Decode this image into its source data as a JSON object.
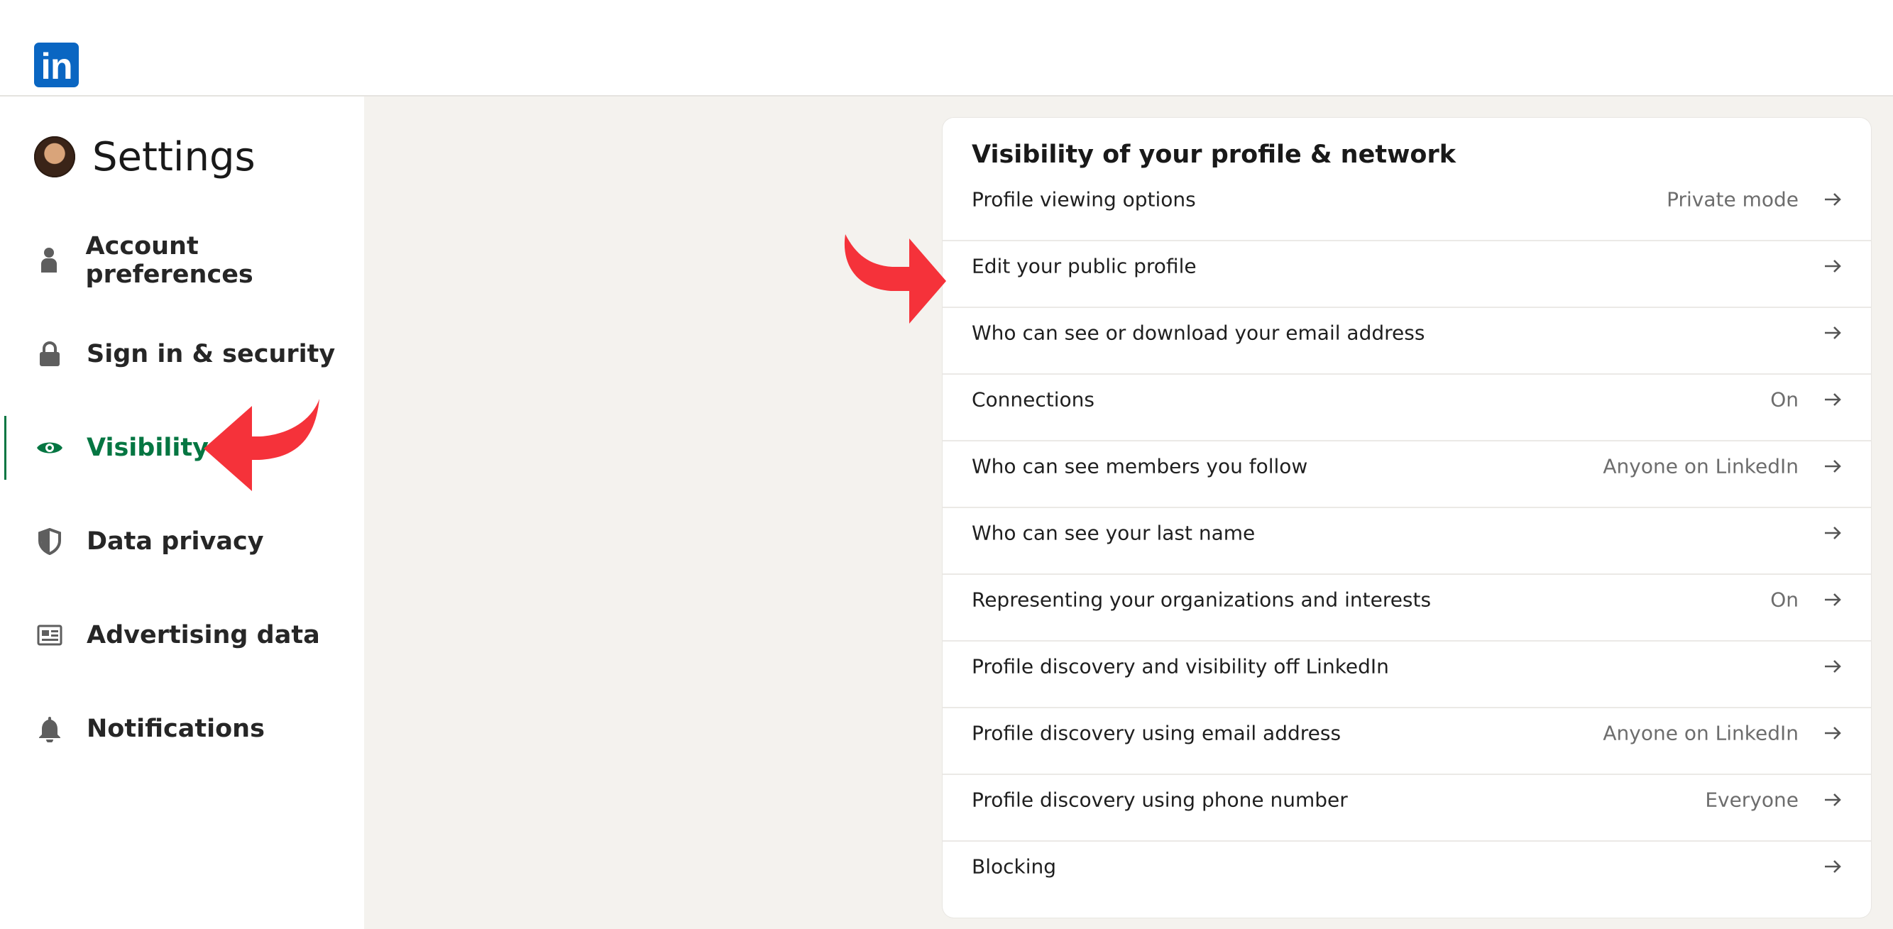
{
  "brand": {
    "logo_text": "in",
    "logo_color": "#0a66c2"
  },
  "sidebar": {
    "title": "Settings",
    "accent_color": "#057642",
    "items": [
      {
        "label": "Account preferences",
        "icon": "person-icon",
        "active": false
      },
      {
        "label": "Sign in & security",
        "icon": "lock-icon",
        "active": false
      },
      {
        "label": "Visibility",
        "icon": "eye-icon",
        "active": true
      },
      {
        "label": "Data privacy",
        "icon": "shield-icon",
        "active": false
      },
      {
        "label": "Advertising data",
        "icon": "ad-icon",
        "active": false
      },
      {
        "label": "Notifications",
        "icon": "bell-icon",
        "active": false
      }
    ]
  },
  "card": {
    "title": "Visibility of your profile & network",
    "rows": [
      {
        "label": "Profile viewing options",
        "value": "Private mode"
      },
      {
        "label": "Edit your public profile",
        "value": ""
      },
      {
        "label": "Who can see or download your email address",
        "value": ""
      },
      {
        "label": "Connections",
        "value": "On"
      },
      {
        "label": "Who can see members you follow",
        "value": "Anyone on LinkedIn"
      },
      {
        "label": "Who can see your last name",
        "value": ""
      },
      {
        "label": "Representing your organizations and interests",
        "value": "On"
      },
      {
        "label": "Profile discovery and visibility off LinkedIn",
        "value": ""
      },
      {
        "label": "Profile discovery using email address",
        "value": "Anyone on LinkedIn"
      },
      {
        "label": "Profile discovery using phone number",
        "value": "Everyone"
      },
      {
        "label": "Blocking",
        "value": ""
      }
    ]
  },
  "annotations": {
    "arrow_color": "#f5323a"
  }
}
